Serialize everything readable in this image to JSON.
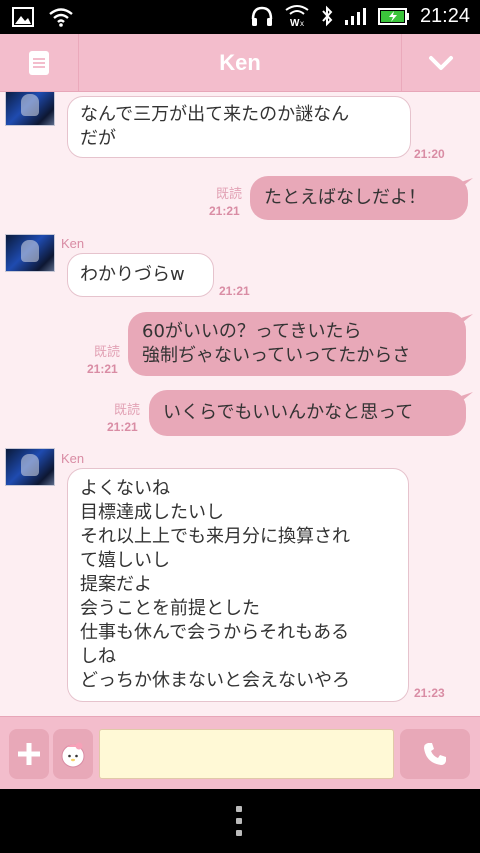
{
  "status_bar": {
    "time": "21:24"
  },
  "header": {
    "title": "Ken"
  },
  "messages": [
    {
      "sender": "",
      "lines": [
        "なんで三万が出て来たのか謎なん",
        "だが"
      ],
      "time": "21:20"
    },
    {
      "read": "既読",
      "lines": [
        "たとえばなしだよ！"
      ],
      "time": "21:21"
    },
    {
      "sender": "Ken",
      "lines": [
        "わかりづらw"
      ],
      "time": "21:21"
    },
    {
      "read": "既読",
      "lines": [
        "60がいいの？ってきいたら",
        "強制ぢゃないっていってたからさ"
      ],
      "time": "21:21"
    },
    {
      "read": "既読",
      "lines": [
        "いくらでもいいんかなと思って"
      ],
      "time": "21:21"
    },
    {
      "sender": "Ken",
      "lines": [
        "よくないね",
        "目標達成したいし",
        "それ以上上でも来月分に換算され",
        "て嬉しいし",
        "提案だよ",
        "会うことを前提とした",
        "仕事も休んで会うからそれもある",
        "しね",
        "どっちか休まないと会えないやろ"
      ],
      "time": "21:23"
    }
  ],
  "composer": {
    "placeholder": "",
    "value": ""
  },
  "colors": {
    "header": "#f3bdcc",
    "chat_bg": "#fdeef2",
    "outgoing_bubble": "#e8a8b8",
    "accent_text": "#d98ca4",
    "input_bg": "#fff9d6"
  },
  "icons": [
    "image-icon",
    "wifi-icon",
    "headphones-icon",
    "wifi-calling-icon",
    "bluetooth-icon",
    "signal-icon",
    "battery-icon",
    "menu-icon",
    "chevron-down-icon",
    "plus-icon",
    "sticker-icon",
    "phone-icon",
    "more-dots-icon"
  ]
}
